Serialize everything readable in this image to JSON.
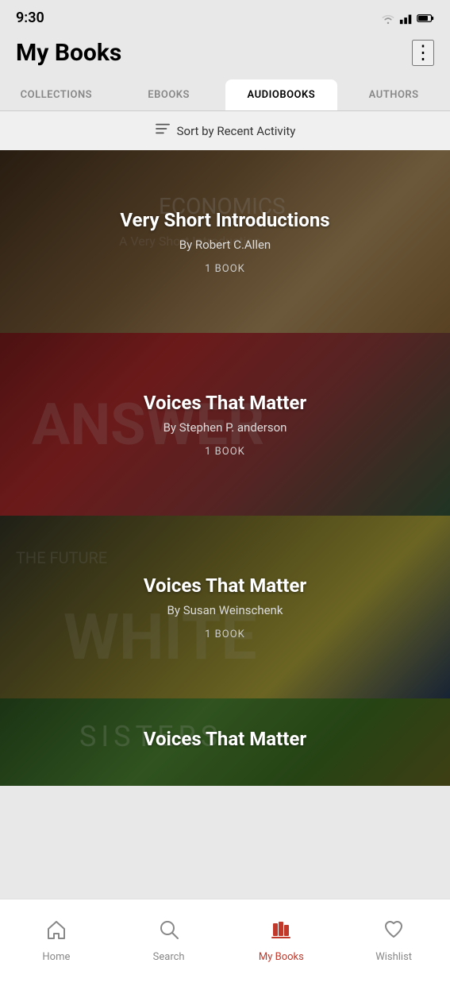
{
  "statusBar": {
    "time": "9:30"
  },
  "header": {
    "title": "My Books",
    "moreLabel": "⋮"
  },
  "tabs": [
    {
      "id": "collections",
      "label": "COLLECTIONS",
      "active": false
    },
    {
      "id": "ebooks",
      "label": "EBOOKS",
      "active": false
    },
    {
      "id": "audiobooks",
      "label": "AUDIOBOOKS",
      "active": true
    },
    {
      "id": "authors",
      "label": "AUTHORS",
      "active": false
    }
  ],
  "sortBar": {
    "label": "Sort by Recent Activity"
  },
  "books": [
    {
      "title": "Very Short Introductions",
      "author": "By Robert C.Allen",
      "count": "1 BOOK",
      "bgClass": "card-bg-1"
    },
    {
      "title": "Voices That Matter",
      "author": "By Stephen P. anderson",
      "count": "1 BOOK",
      "bgClass": "card-bg-2"
    },
    {
      "title": "Voices That Matter",
      "author": "By Susan Weinschenk",
      "count": "1 BOOK",
      "bgClass": "card-bg-3"
    },
    {
      "title": "Voices That Matter",
      "author": "",
      "count": "",
      "bgClass": "card-bg-4"
    }
  ],
  "bottomNav": [
    {
      "id": "home",
      "label": "Home",
      "icon": "home",
      "active": false
    },
    {
      "id": "search",
      "label": "Search",
      "icon": "search",
      "active": false
    },
    {
      "id": "mybooks",
      "label": "My Books",
      "icon": "books",
      "active": true
    },
    {
      "id": "wishlist",
      "label": "Wishlist",
      "icon": "heart",
      "active": false
    }
  ]
}
